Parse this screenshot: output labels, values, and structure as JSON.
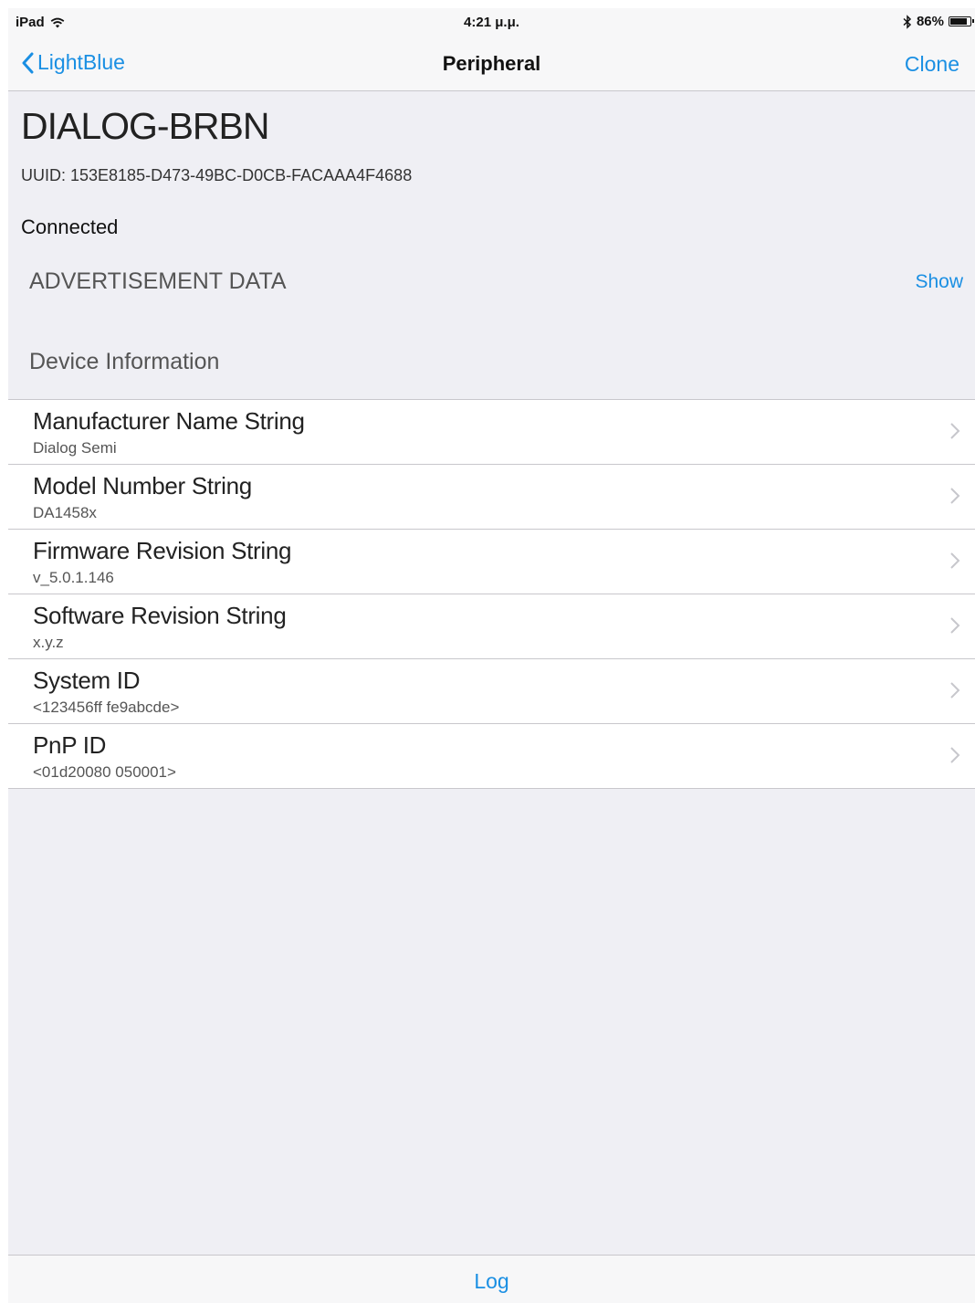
{
  "status_bar": {
    "device": "iPad",
    "time": "4:21 μ.μ.",
    "battery_text": "86%",
    "battery_level": 0.86
  },
  "nav": {
    "back_label": "LightBlue",
    "title": "Peripheral",
    "right_label": "Clone"
  },
  "peripheral": {
    "name": "DIALOG-BRBN",
    "uuid": "UUID: 153E8185-D473-49BC-D0CB-FACAAA4F4688",
    "status": "Connected"
  },
  "advertisement": {
    "title": "ADVERTISEMENT DATA",
    "action": "Show"
  },
  "service": {
    "title": "Device Information",
    "characteristics": [
      {
        "name": "Manufacturer Name String",
        "value": "Dialog Semi"
      },
      {
        "name": "Model Number String",
        "value": "DA1458x"
      },
      {
        "name": "Firmware Revision String",
        "value": "v_5.0.1.146"
      },
      {
        "name": "Software Revision String",
        "value": "x.y.z"
      },
      {
        "name": "System ID",
        "value": "<123456ff fe9abcde>"
      },
      {
        "name": "PnP ID",
        "value": "<01d20080 050001>"
      }
    ]
  },
  "toolbar": {
    "log_label": "Log"
  },
  "colors": {
    "accent": "#1a8fe3",
    "background": "#efeff4",
    "separator": "#c8c7cc"
  }
}
